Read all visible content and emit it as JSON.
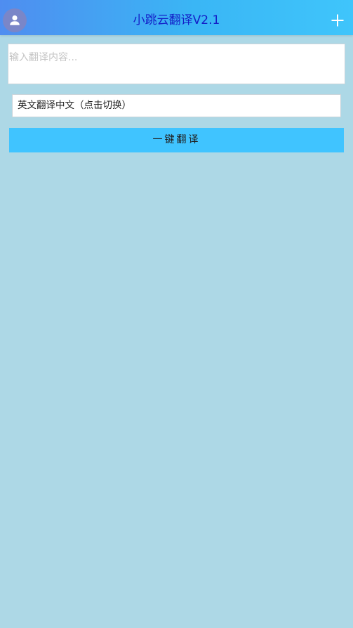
{
  "header": {
    "title": "小跳云翻译V2.1",
    "avatar_icon": "user-icon",
    "add_icon": "plus-icon",
    "gradient_start": "#4f8df0",
    "gradient_end": "#3fc5fb",
    "title_color": "#1420c8"
  },
  "input": {
    "value": "",
    "placeholder": "输入翻译内容..."
  },
  "mode": {
    "label": "英文翻译中文（点击切换）"
  },
  "action": {
    "translate_label": "一键翻译",
    "color": "#40c4ff"
  },
  "page": {
    "background": "#add8e6"
  }
}
